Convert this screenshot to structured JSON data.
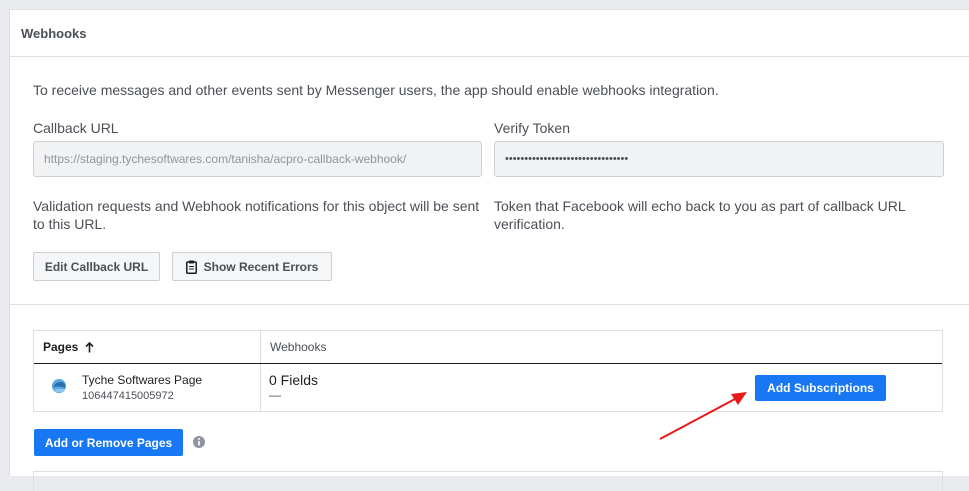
{
  "panel": {
    "title": "Webhooks",
    "intro": "To receive messages and other events sent by Messenger users, the app should enable webhooks integration."
  },
  "callback": {
    "label": "Callback URL",
    "value": "https://staging.tychesoftwares.com/tanisha/acpro-callback-webhook/",
    "help": "Validation requests and Webhook notifications for this object will be sent to this URL."
  },
  "verify": {
    "label": "Verify Token",
    "value": "••••••••••••••••••••••••••••••••",
    "help": "Token that Facebook will echo back to you as part of callback URL verification."
  },
  "buttons": {
    "edit_callback": "Edit Callback URL",
    "show_errors": "Show Recent Errors",
    "add_subscriptions": "Add Subscriptions",
    "add_remove_pages": "Add or Remove Pages"
  },
  "table": {
    "col_pages": "Pages",
    "col_webhooks": "Webhooks",
    "rows": [
      {
        "page_name": "Tyche Softwares Page",
        "page_id": "106447415005972",
        "fields": "0 Fields",
        "fields_sub": "—"
      }
    ]
  },
  "icons": {
    "clipboard": "clipboard-icon",
    "sort": "arrow-up-icon",
    "page_avatar": "page-avatar",
    "info": "info-icon",
    "annotation": "red-arrow"
  },
  "colors": {
    "primary": "#1877f2",
    "annotation": "#e8191a"
  }
}
